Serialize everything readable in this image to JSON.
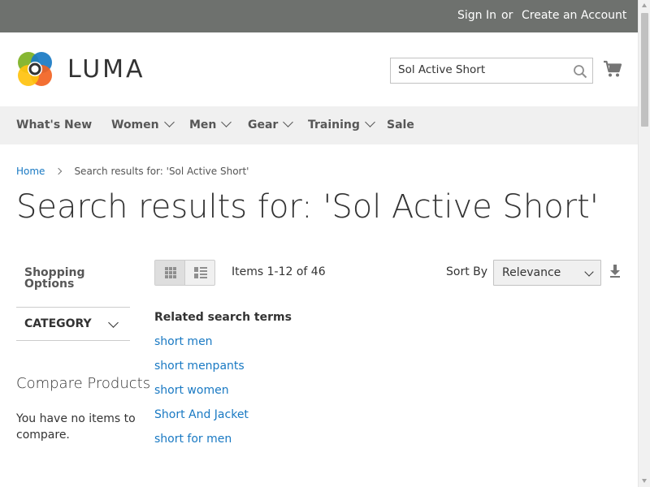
{
  "topbar": {
    "signin": "Sign In",
    "or": "or",
    "create_account": "Create an Account"
  },
  "header": {
    "logo_text": "LUMA",
    "search_value": "Sol Active Short",
    "search_icon": "search-icon",
    "cart_icon": "cart-icon"
  },
  "nav": {
    "items": [
      {
        "label": "What's New",
        "dropdown": false
      },
      {
        "label": "Women",
        "dropdown": true
      },
      {
        "label": "Men",
        "dropdown": true
      },
      {
        "label": "Gear",
        "dropdown": true
      },
      {
        "label": "Training",
        "dropdown": true
      },
      {
        "label": "Sale",
        "dropdown": false
      }
    ]
  },
  "breadcrumb": {
    "home": "Home",
    "current": "Search results for: 'Sol Active Short'"
  },
  "page_title": "Search results for: 'Sol Active Short'",
  "sidebar": {
    "shopping_options": "Shopping Options",
    "category": "CATEGORY",
    "compare_title": "Compare Products",
    "compare_empty": "You have no items to compare."
  },
  "toolbar": {
    "view_modes": [
      "grid",
      "list"
    ],
    "active_mode": "grid",
    "items_count": "Items 1-12 of 46",
    "sort_label": "Sort By",
    "sort_value": "Relevance",
    "sort_direction_icon": "arrow-down-icon"
  },
  "related": {
    "title": "Related search terms",
    "terms": [
      "short men",
      "short menpants",
      "short women",
      "Short And Jacket",
      "short for men"
    ]
  },
  "colors": {
    "topbar_bg": "#6e716e",
    "nav_bg": "#f0f0f0",
    "link": "#1979c3",
    "logo_orange": "#f26322",
    "logo_green": "#7db122",
    "logo_blue": "#1979c3",
    "logo_yellow": "#ffc20e"
  }
}
